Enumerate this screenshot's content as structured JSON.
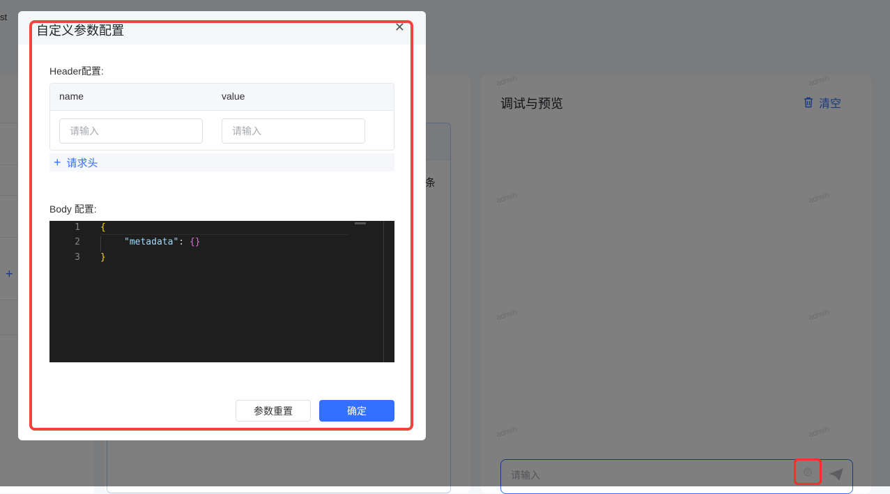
{
  "background": {
    "top_left_fragment": "st",
    "middle_fragment": "条",
    "debug_panel": {
      "title": "调试与预览",
      "clear_label": "清空"
    },
    "chat_input": {
      "placeholder": "请输入"
    },
    "watermark_text": "admin"
  },
  "dialog": {
    "title": "自定义参数配置",
    "header_section": {
      "label": "Header配置:",
      "columns": [
        "name",
        "value"
      ],
      "row": {
        "name_placeholder": "请输入",
        "value_placeholder": "请输入"
      },
      "add_label": "请求头"
    },
    "body_section": {
      "label": "Body 配置:",
      "code_lines": [
        {
          "number": "1",
          "text": "{"
        },
        {
          "number": "2",
          "key": "\"metadata\"",
          "colon": ": ",
          "value": "{}"
        },
        {
          "number": "3",
          "text": "}"
        }
      ]
    },
    "buttons": {
      "reset": "参数重置",
      "confirm": "确定"
    }
  },
  "colors": {
    "accent": "#3370ff",
    "highlight": "#f0443d",
    "editor_bg": "#1e1e1e"
  }
}
